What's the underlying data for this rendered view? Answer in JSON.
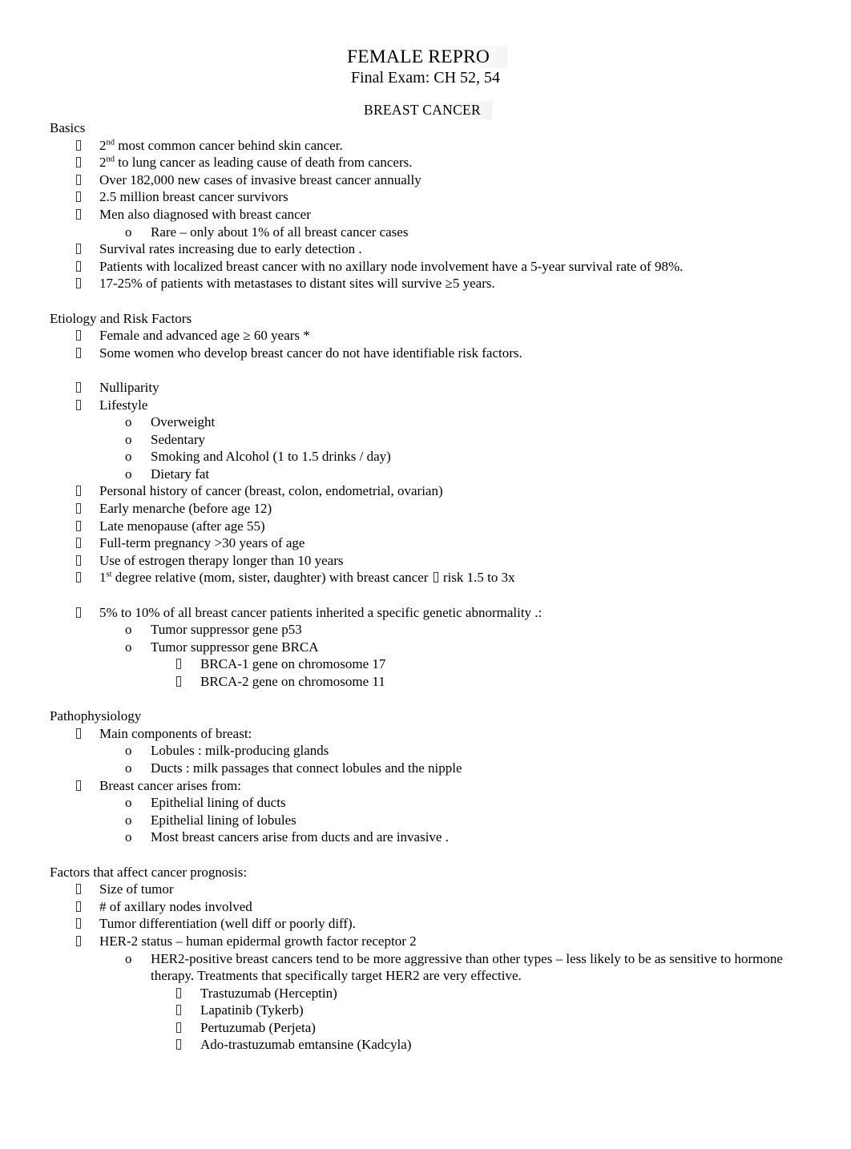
{
  "document": {
    "title": "FEMALE REPRO",
    "subtitle": "Final Exam: CH 52, 54",
    "section_heading": "BREAST CANCER"
  },
  "sections": {
    "basics": {
      "heading": "Basics",
      "items": [
        "most common  cancer behind skin cancer.",
        "to lung cancer   as leading cause of death  from cancers.",
        "Over 182,000 new cases of invasive breast cancer annually",
        "2.5 million breast cancer survivors",
        "Men also diagnosed with breast cancer",
        "Rare – only about 1% of all breast cancer cases",
        "Survival rates increasing   due to early detection .",
        "Patients with localized breast cancer with no axillary node involvement have a 5-year survival rate of 98%.",
        "17-25% of patients with metastases to distant sites will survive ≥5 years."
      ],
      "sup_prefix_1": "2",
      "sup_1": "nd",
      "sup_prefix_2": "2",
      "sup_2": "nd"
    },
    "etiology": {
      "heading": "Etiology and Risk Factors",
      "items": [
        "Female and advanced age ≥ 60 years *",
        "Some women who develop breast cancer do not have identifiable risk factors.",
        "Nulliparity",
        "Lifestyle",
        "Overweight",
        "Sedentary",
        "Smoking and Alcohol (1 to 1.5 drinks / day)",
        "Dietary fat",
        "Personal history of cancer   (breast, colon, endometrial, ovarian)",
        "Early menarche   (before age 12)",
        "Late menopause  (after age 55)",
        "Full-term pregnancy >30   years of age",
        "Use of estrogen therapy   longer than 10 years"
      ],
      "relative_prefix": "1",
      "relative_sup": "st",
      "relative_text": " degree relative   (mom, sister, daughter) with breast cancer ",
      "relative_tail": " risk 1.5 to 3x",
      "genetic": "5% to 10% of all breast cancer patients inherited a specific genetic abnormality  .:",
      "genes": [
        "Tumor suppressor gene  p53",
        "Tumor suppressor gene  BRCA"
      ],
      "brca": [
        "BRCA-1 gene on chromosome 17",
        "BRCA-2 gene on chromosome 11"
      ]
    },
    "pathophysiology": {
      "heading": "Pathophysiology",
      "components_label": "Main components of breast:",
      "components": [
        "Lobules : milk-producing glands",
        "Ducts : milk passages that connect lobules and the nipple"
      ],
      "arises_label": "Breast cancer arises from:",
      "arises": [
        "Epithelial lining of ducts",
        "Epithelial lining of lobules",
        "Most breast cancers arise from ducts and are invasive   ."
      ]
    },
    "prognosis": {
      "heading": "Factors that affect cancer prognosis:",
      "items": [
        "Size of tumor",
        "# of axillary nodes  involved",
        "Tumor differentiation   (well diff or poorly diff).",
        "HER-2 status  – human epidermal growth factor receptor 2"
      ],
      "her2_note": "HER2-positive breast cancers tend to be more aggressive  than other types – less likely to be as sensitive to hormone therapy. Treatments that specifically target HER2 are very effective.",
      "drugs": [
        "Trastuzumab (Herceptin)",
        "Lapatinib (Tykerb)",
        "Pertuzumab (Perjeta)",
        "Ado-trastuzumab emtansine (Kadcyla)"
      ]
    }
  }
}
